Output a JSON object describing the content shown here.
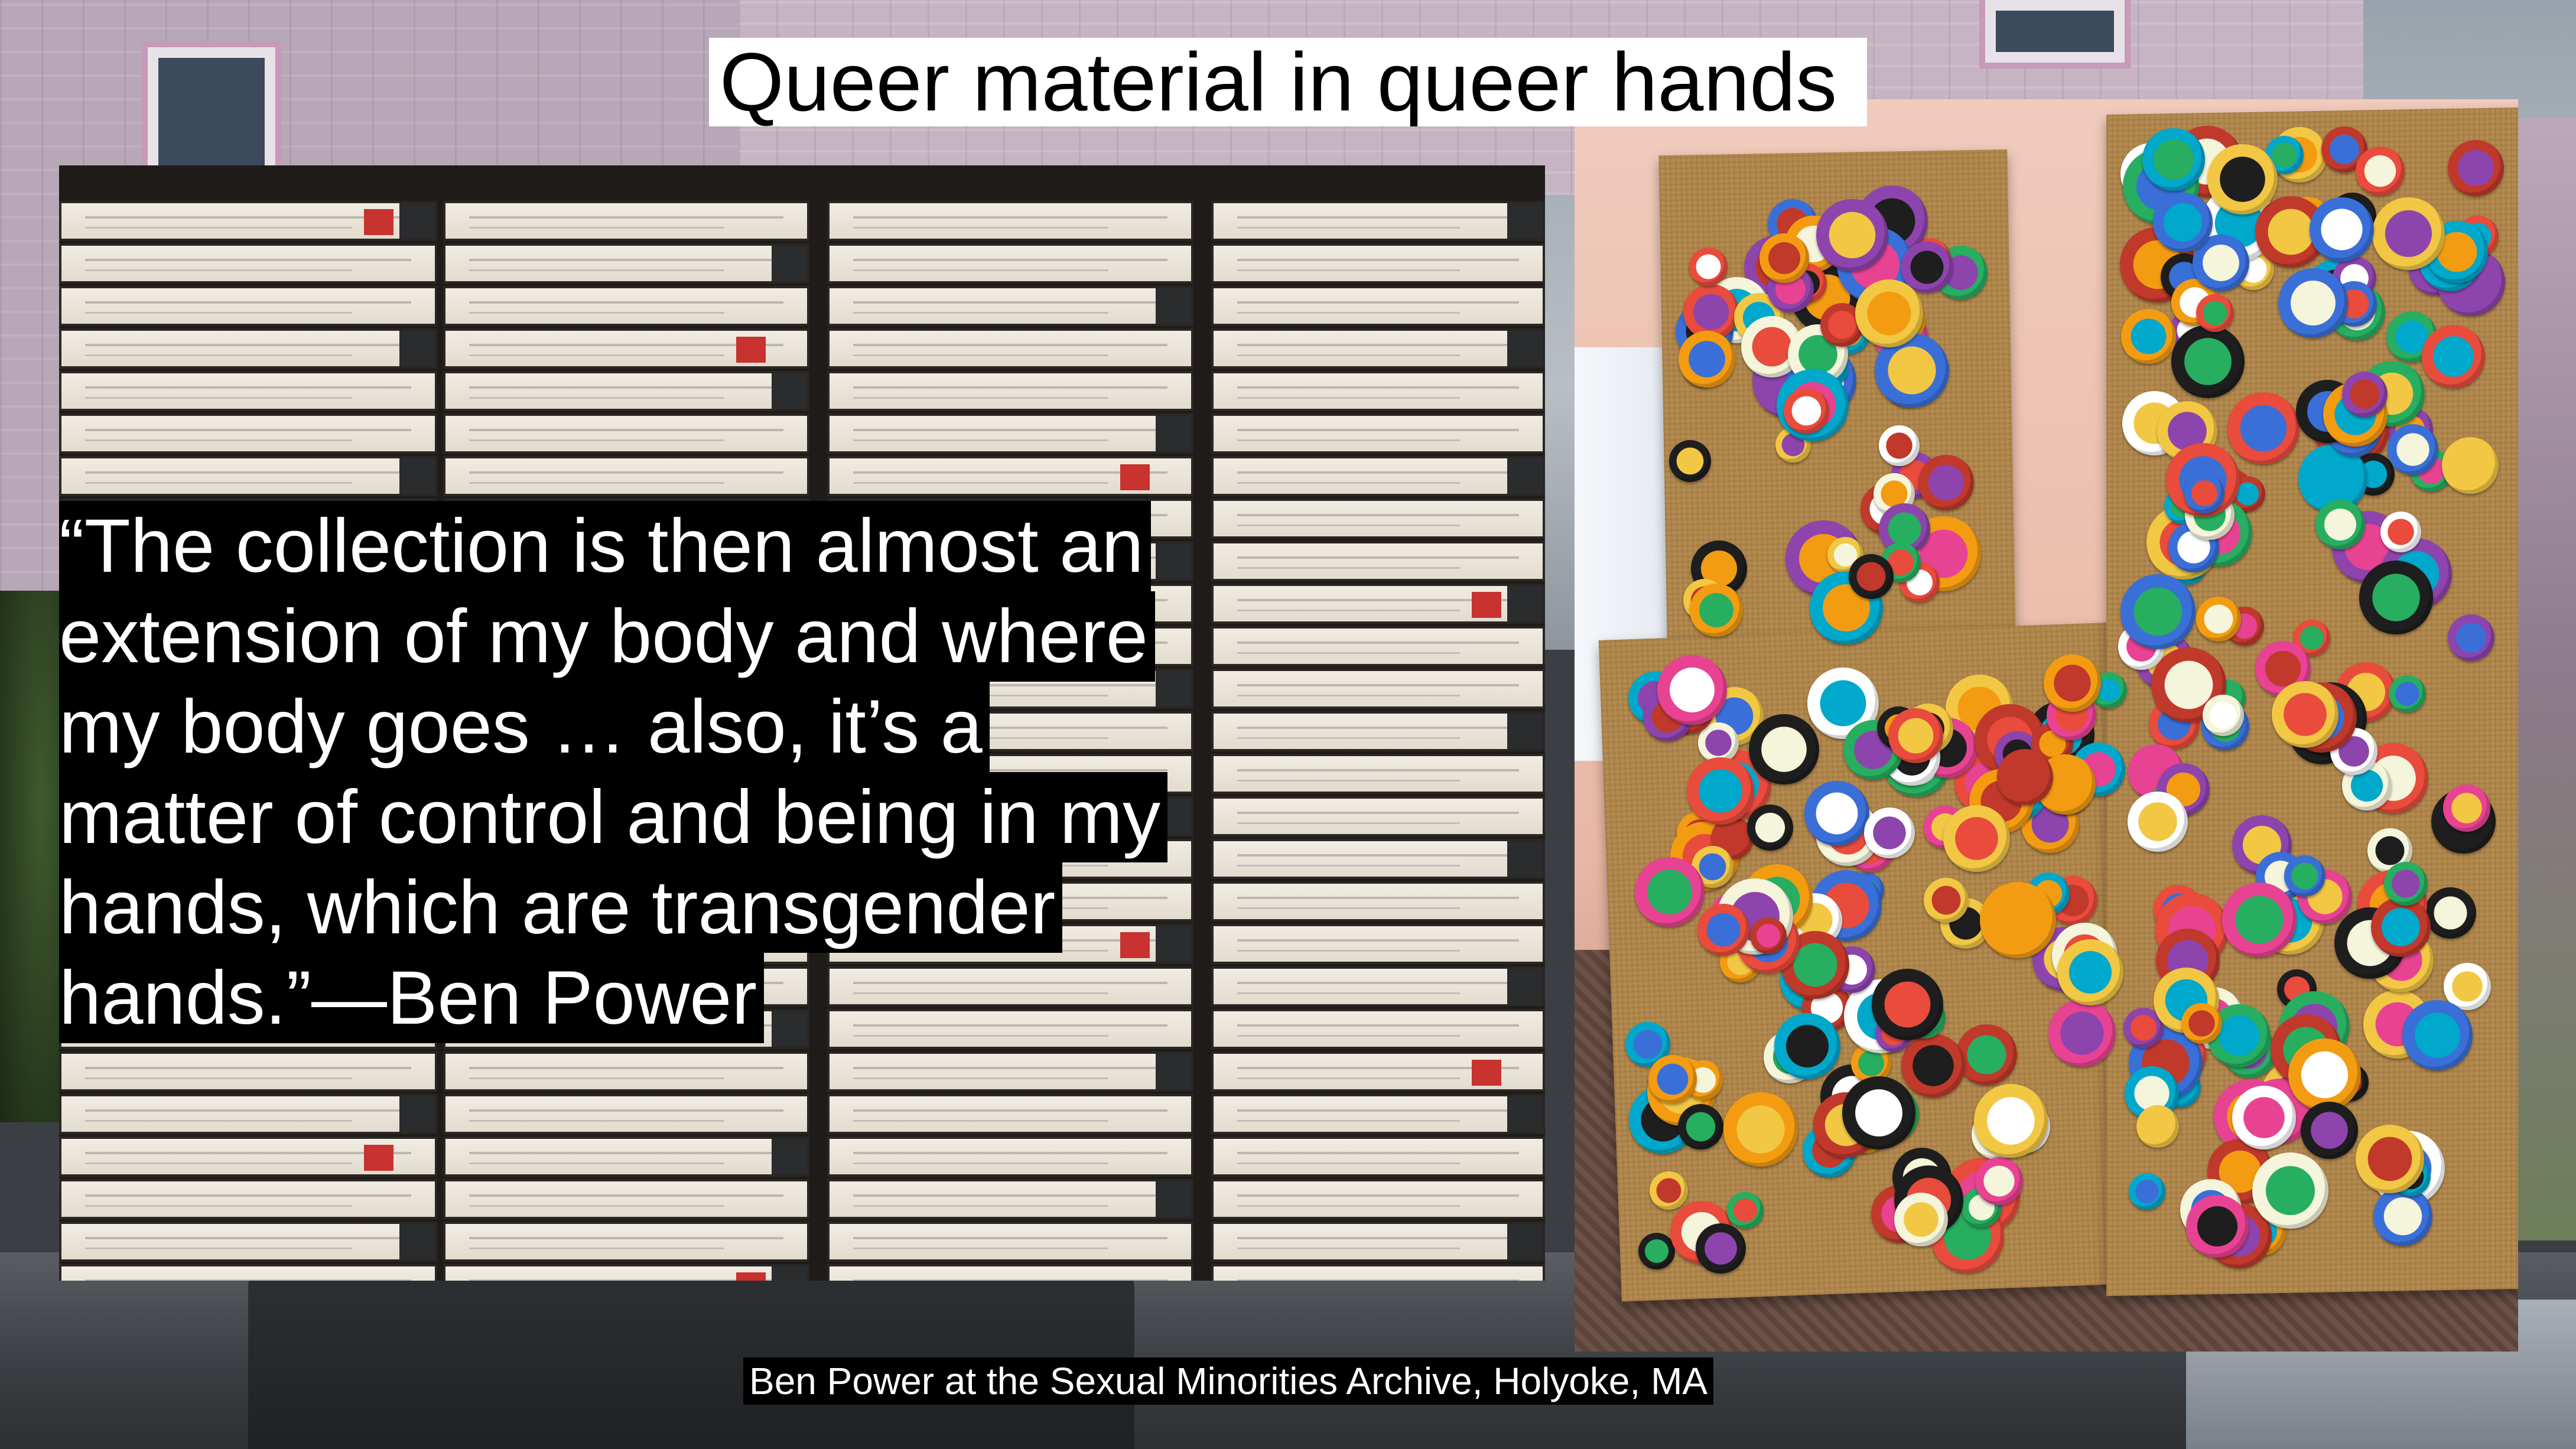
{
  "slide": {
    "title": "Queer material in queer hands",
    "quote_lines": [
      "“The collection is then almost an",
      "extension of my body and where",
      "my body goes … also, it’s a",
      "matter of control and being in my",
      "hands, which are transgender",
      "hands.”—Ben Power"
    ],
    "caption": "Ben Power at the Sexual Minorities Archive, Holyoke, MA"
  },
  "images": {
    "left_photo": "cassette-tapes-photo",
    "right_photo": "pin-buttons-corkboard-photo",
    "background": "pink-house-street-photo"
  },
  "colors": {
    "title_bg": "#ffffff",
    "quote_bg": "#000000",
    "quote_text": "#ffffff",
    "caption_bg": "#000000"
  }
}
